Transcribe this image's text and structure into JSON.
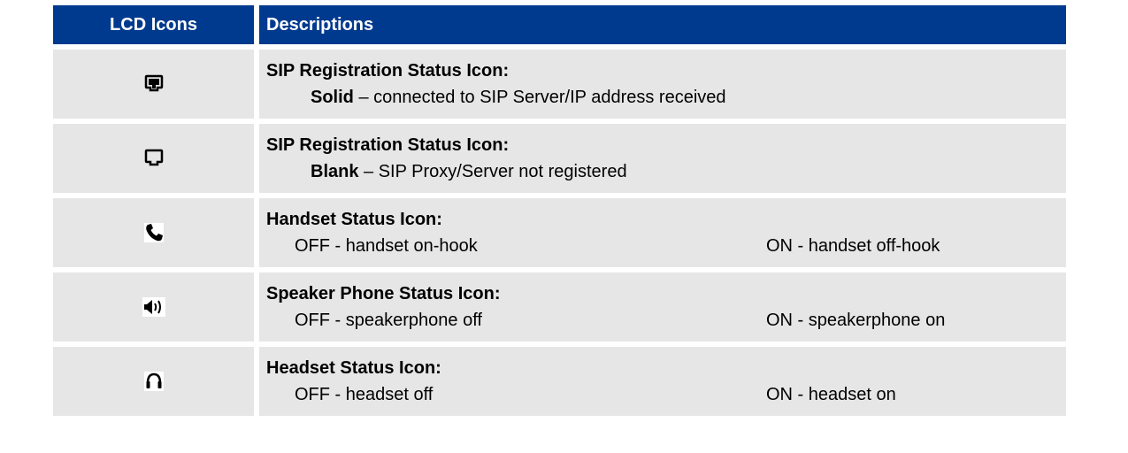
{
  "header": {
    "col1": "LCD Icons",
    "col2": "Descriptions"
  },
  "rows": [
    {
      "icon": "sip-solid-icon",
      "title": "SIP Registration Status Icon:",
      "state": "Solid",
      "text": " – connected to SIP Server/IP address received"
    },
    {
      "icon": "sip-blank-icon",
      "title": "SIP Registration Status Icon:",
      "state": "Blank",
      "text": " – SIP Proxy/Server not registered"
    },
    {
      "icon": "handset-icon",
      "title": "Handset Status Icon:",
      "off": "OFF - handset on-hook",
      "on": "ON - handset off-hook"
    },
    {
      "icon": "speaker-icon",
      "title": "Speaker Phone Status Icon:",
      "off": "OFF - speakerphone off",
      "on": "ON - speakerphone on"
    },
    {
      "icon": "headset-icon",
      "title": "Headset Status Icon:",
      "off": "OFF - headset off",
      "on": "ON - headset on"
    }
  ],
  "colors": {
    "header_bg": "#003A8F",
    "row_bg": "#E6E6E6"
  }
}
